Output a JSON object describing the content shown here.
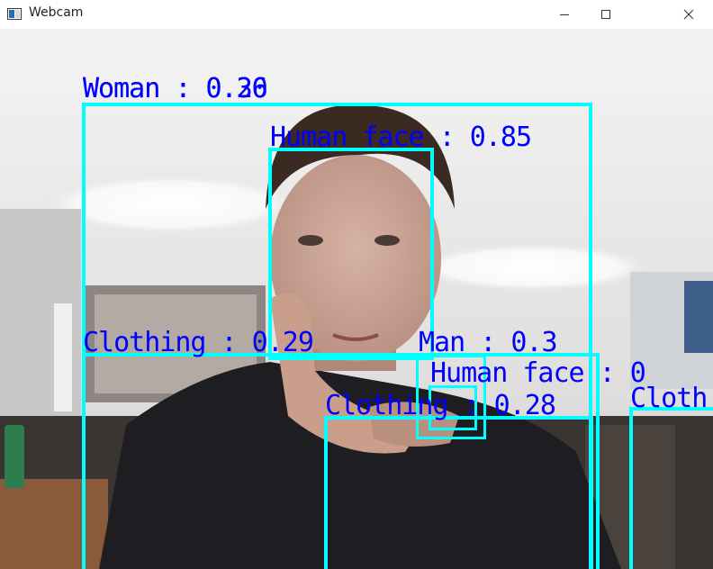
{
  "window": {
    "title": "Webcam",
    "controls": {
      "minimize_icon": "minimize-icon",
      "maximize_icon": "maximize-icon",
      "close_icon": "close-icon"
    }
  },
  "colors": {
    "box": "#00ffff",
    "label": "#0000ff"
  },
  "detections": {
    "woman": {
      "label": "Woman : 0.26"
    },
    "overlap": {
      "label": "Woman : 0.30"
    },
    "face_main": {
      "label": "Human face : 0.85"
    },
    "clothing_left": {
      "label": "Clothing : 0.29"
    },
    "man": {
      "label": "Man : 0.3"
    },
    "face_small": {
      "label": "Human face : 0"
    },
    "clothing_mid": {
      "label": "Clothing : 0.28"
    },
    "clothing_right": {
      "label": "Cloth"
    }
  }
}
